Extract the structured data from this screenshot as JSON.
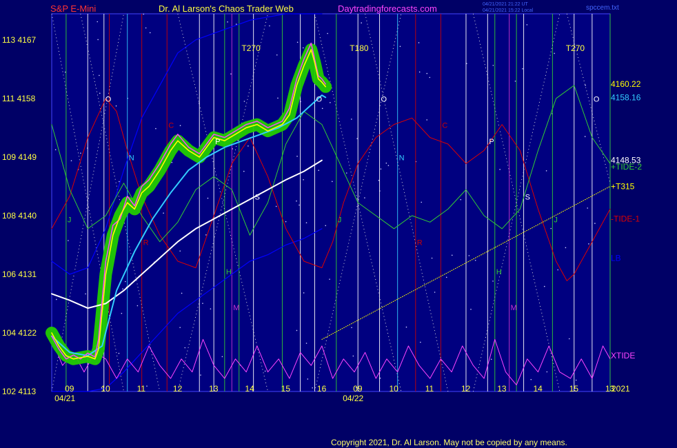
{
  "header": {
    "symbol": "S&P E-Mini",
    "title": "Dr. Al Larson's Chaos Trader Web",
    "site": "Daytradingforecasts.com",
    "stamp1": "04/21/2021 21:22 UT",
    "stamp2": "04/21/2021 15:22 Local",
    "file": "spccem.txt"
  },
  "footer": {
    "copyright": "Copyright 2021, Dr. Al Larson. May not be copied by any means."
  },
  "colors": {
    "background": "#000066",
    "plot_bg": "#000080",
    "axis": "#4444ff",
    "green_glow": "#22cc00",
    "yellow": "#ffff00",
    "magenta": "#ff44ff",
    "cyan": "#33ccff",
    "white": "#ffffff",
    "red": "#dd0000",
    "green": "#33cc33",
    "blue": "#0000ff",
    "pink": "#cc33cc"
  },
  "chart_data": {
    "type": "line",
    "y_left_ticks": [
      {
        "pair": "113  4167",
        "value": 4167
      },
      {
        "pair": "111  4158",
        "value": 4158
      },
      {
        "pair": "109  4149",
        "value": 4149
      },
      {
        "pair": "108  4140",
        "value": 4140
      },
      {
        "pair": "106  4131",
        "value": 4131
      },
      {
        "pair": "104  4122",
        "value": 4122
      },
      {
        "pair": "102  4113",
        "value": 4113
      }
    ],
    "ylim": [
      4113,
      4171
    ],
    "xlim": [
      8.5,
      24.0
    ],
    "x_ticks": [
      {
        "label": "09",
        "x": 9
      },
      {
        "label": "10",
        "x": 10
      },
      {
        "label": "11",
        "x": 11
      },
      {
        "label": "12",
        "x": 12
      },
      {
        "label": "13",
        "x": 13
      },
      {
        "label": "14",
        "x": 14
      },
      {
        "label": "15",
        "x": 15
      },
      {
        "label": "16",
        "x": 16
      },
      {
        "label": "09",
        "x": 17
      },
      {
        "label": "10",
        "x": 18
      },
      {
        "label": "11",
        "x": 19
      },
      {
        "label": "12",
        "x": 20
      },
      {
        "label": "13",
        "x": 21
      },
      {
        "label": "14",
        "x": 22
      },
      {
        "label": "15",
        "x": 23
      },
      {
        "label": "13",
        "x": 24
      }
    ],
    "dates": [
      {
        "label": "04/21",
        "x": 9
      },
      {
        "label": "04/22",
        "x": 17
      }
    ],
    "year": "2021",
    "top_markers": [
      {
        "label": "T270",
        "x": 14.0
      },
      {
        "label": "T180",
        "x": 17.0
      },
      {
        "label": "T270",
        "x": 23.0
      }
    ],
    "right_labels": [
      {
        "text": "4160.22",
        "value": 4160.2,
        "color": "#ffff00"
      },
      {
        "text": "4158.16",
        "value": 4158.16,
        "color": "#33ccff"
      },
      {
        "text": "4148.53",
        "value": 4148.53,
        "color": "#ffffff"
      },
      {
        "text": "+TIDE-2",
        "value": 4147.5,
        "color": "#33cc33"
      },
      {
        "text": "+T315",
        "value": 4144.5,
        "color": "#ffff00"
      },
      {
        "text": "-TIDE-1",
        "value": 4139.5,
        "color": "#dd0000"
      },
      {
        "text": "LB",
        "value": 4133.5,
        "color": "#0000ff"
      },
      {
        "text": "XTIDE",
        "value": 4118.5,
        "color": "#ff44ff"
      }
    ],
    "price": {
      "x": [
        8.5,
        8.7,
        8.9,
        9.1,
        9.3,
        9.5,
        9.7,
        9.8,
        10.0,
        10.2,
        10.4,
        10.6,
        10.8,
        11.0,
        11.2,
        11.5,
        11.8,
        12.0,
        12.3,
        12.6,
        12.8,
        13.0,
        13.3,
        13.6,
        13.9,
        14.2,
        14.5,
        14.7,
        14.9,
        15.1,
        15.3,
        15.5,
        15.7,
        15.8,
        15.9,
        16.0,
        16.1
      ],
      "y": [
        4122.0,
        4120.0,
        4118.5,
        4118.0,
        4118.2,
        4118.4,
        4118.0,
        4119.5,
        4131.0,
        4137.0,
        4140.0,
        4142.0,
        4141.0,
        4143.5,
        4144.5,
        4147.0,
        4150.0,
        4151.5,
        4150.0,
        4149.0,
        4150.5,
        4152.0,
        4151.5,
        4152.5,
        4153.5,
        4154.0,
        4153.0,
        4153.5,
        4154.0,
        4155.5,
        4160.0,
        4163.0,
        4165.5,
        4163.5,
        4161.0,
        4160.5,
        4159.8
      ]
    },
    "magenta_fast": {
      "x": [
        8.5,
        8.7,
        8.9,
        9.1,
        9.3,
        9.5,
        9.7,
        9.8,
        10.0,
        10.2,
        10.4,
        10.6,
        10.8,
        11.0,
        11.2,
        11.5,
        11.8,
        12.0,
        12.3,
        12.6,
        12.8,
        13.0,
        13.3,
        13.6,
        13.9,
        14.2,
        14.5,
        14.7,
        14.9,
        15.1,
        15.3,
        15.5,
        15.7,
        15.8,
        15.9,
        16.0,
        16.1
      ],
      "y": [
        4121.5,
        4119.5,
        4118.0,
        4118.6,
        4118.0,
        4118.9,
        4118.3,
        4121.0,
        4133.0,
        4138.5,
        4139.5,
        4143.0,
        4141.5,
        4144.5,
        4145.5,
        4148.0,
        4151.0,
        4152.5,
        4150.5,
        4149.5,
        4151.0,
        4152.5,
        4152.0,
        4153.0,
        4154.0,
        4154.5,
        4153.5,
        4154.0,
        4154.5,
        4156.5,
        4161.0,
        4164.0,
        4166.5,
        4164.0,
        4161.5,
        4161.0,
        4160.2
      ]
    },
    "cyan_avg": {
      "x": [
        8.5,
        9.0,
        9.5,
        9.9,
        10.3,
        10.8,
        11.3,
        11.8,
        12.3,
        12.8,
        13.3,
        13.8,
        14.3,
        14.8,
        15.3,
        15.7,
        16.0,
        16.1
      ],
      "y": [
        4121.5,
        4119.0,
        4118.5,
        4120.0,
        4128.5,
        4134.5,
        4139.5,
        4143.5,
        4147.0,
        4149.0,
        4150.5,
        4151.5,
        4152.5,
        4153.5,
        4155.0,
        4157.0,
        4158.5,
        4158.16
      ]
    },
    "white_avg": {
      "x": [
        8.5,
        9.0,
        9.5,
        10.0,
        10.5,
        11.0,
        11.5,
        12.0,
        12.5,
        13.0,
        13.5,
        14.0,
        14.5,
        15.0,
        15.5,
        16.0
      ],
      "y": [
        4128.0,
        4127.0,
        4125.8,
        4126.5,
        4128.5,
        4131.0,
        4133.5,
        4136.0,
        4138.0,
        4139.5,
        4141.0,
        4142.5,
        4144.0,
        4145.5,
        4146.8,
        4148.5
      ]
    },
    "tide1_red": {
      "x": [
        8.5,
        9.0,
        9.5,
        10.0,
        10.3,
        10.6,
        11.0,
        11.5,
        12.0,
        12.5,
        13.0,
        13.5,
        14.0,
        14.5,
        15.0,
        15.5,
        16.0,
        16.3,
        16.6,
        17.0,
        17.5,
        18.0,
        18.5,
        19.0,
        19.5,
        20.0,
        20.5,
        21.0,
        21.5,
        22.0,
        22.5,
        22.8,
        23.0,
        23.5,
        24.0
      ],
      "y": [
        4138,
        4143,
        4152,
        4158,
        4156,
        4150,
        4143,
        4137,
        4133,
        4132,
        4140,
        4148,
        4152,
        4146,
        4138,
        4133,
        4132,
        4136,
        4142,
        4148,
        4152,
        4154,
        4155,
        4152,
        4151,
        4148,
        4150,
        4154,
        4150,
        4141,
        4133,
        4130,
        4131,
        4136,
        4141
      ]
    },
    "tide2_green": {
      "x": [
        8.5,
        9.0,
        9.5,
        10.0,
        10.5,
        11.0,
        11.5,
        12.0,
        12.5,
        13.0,
        13.5,
        14.0,
        14.5,
        15.0,
        15.5,
        16.0,
        16.5,
        17.0,
        17.5,
        18.0,
        18.5,
        19.0,
        19.5,
        20.0,
        20.5,
        21.0,
        21.5,
        22.0,
        22.5,
        23.0,
        23.5,
        24.0
      ],
      "y": [
        4154,
        4144,
        4138,
        4140,
        4145,
        4140,
        4136,
        4139,
        4144,
        4146,
        4144,
        4137,
        4142,
        4151,
        4156,
        4154,
        4148,
        4142,
        4140,
        4138,
        4140,
        4139,
        4141,
        4144,
        4140,
        4138,
        4141,
        4150,
        4158,
        4160,
        4152,
        4148
      ]
    },
    "xtide": {
      "x": [
        8.5,
        8.8,
        9.1,
        9.4,
        9.7,
        10.0,
        10.3,
        10.6,
        10.9,
        11.2,
        11.5,
        11.8,
        12.1,
        12.4,
        12.7,
        13.0,
        13.3,
        13.6,
        13.9,
        14.2,
        14.5,
        14.8,
        15.1,
        15.4,
        15.7,
        16.0,
        16.3,
        16.6,
        16.9,
        17.2,
        17.5,
        17.8,
        18.1,
        18.4,
        18.7,
        19.0,
        19.3,
        19.6,
        19.9,
        20.2,
        20.5,
        20.8,
        21.1,
        21.4,
        21.7,
        22.0,
        22.3,
        22.6,
        22.9,
        23.2,
        23.5,
        23.8,
        24.0
      ],
      "y": [
        4121,
        4117,
        4119,
        4116,
        4119,
        4118,
        4115,
        4118,
        4116,
        4120,
        4117,
        4115,
        4118,
        4116,
        4121,
        4117,
        4115,
        4118,
        4116,
        4120,
        4116,
        4118,
        4115,
        4119,
        4117,
        4120,
        4115,
        4118,
        4116,
        4119,
        4115,
        4118,
        4116,
        4120,
        4117,
        4115,
        4118,
        4116,
        4120,
        4117,
        4115,
        4121,
        4116,
        4114,
        4118,
        4116,
        4120,
        4116,
        4115,
        4118,
        4115,
        4120,
        4118
      ]
    },
    "band_upper": {
      "x": [
        8.5,
        9.0,
        9.5,
        10.0,
        10.5,
        11.0,
        11.5,
        12.0,
        12.5,
        13.0,
        13.5,
        14.0,
        14.5,
        15.0,
        15.5,
        16.0
      ],
      "y": [
        4133,
        4131,
        4132,
        4138,
        4147,
        4155,
        4160,
        4165,
        4167,
        4168,
        4169,
        4170,
        4170.5,
        4171,
        4171,
        4171
      ]
    },
    "band_lower": {
      "x": [
        8.5,
        9.0,
        9.5,
        10.0,
        10.5,
        11.0,
        11.5,
        12.0,
        12.5,
        13.0,
        13.5,
        14.0,
        14.5,
        15.0,
        15.5,
        16.0
      ],
      "y": [
        4113,
        4113,
        4113,
        4113.5,
        4116,
        4119,
        4122,
        4125,
        4127,
        4129,
        4131,
        4133,
        4134,
        4135.5,
        4136.5,
        4138
      ]
    },
    "t315_line": {
      "x": [
        16.0,
        24.0
      ],
      "y": [
        4121.0,
        4144.5
      ]
    },
    "vertical_lines": [
      {
        "x": 8.9,
        "label": "J",
        "label_value": 4139.0,
        "color": "#33cc33",
        "label_color": "#33cc33",
        "style": "solid"
      },
      {
        "x": 9.5,
        "label": "",
        "color": "#ffffff",
        "style": "solid"
      },
      {
        "x": 9.95,
        "label": "O",
        "label_value": 4157.5,
        "color": "#ffffff",
        "label_color": "#ffffff",
        "style": "solid"
      },
      {
        "x": 10.1,
        "label": "",
        "color": "#cc0000",
        "style": "solid"
      },
      {
        "x": 10.6,
        "label": "N",
        "label_value": 4148.5,
        "color": "#33ccff",
        "label_color": "#33ccff",
        "style": "solid"
      },
      {
        "x": 11.0,
        "label": "R",
        "label_value": 4135.5,
        "color": "#cc0000",
        "label_color": "#cc0000",
        "style": "solid"
      },
      {
        "x": 11.7,
        "label": "C",
        "label_value": 4153.5,
        "color": "#cc0000",
        "label_color": "#cc0000",
        "style": "solid"
      },
      {
        "x": 12.6,
        "label": "",
        "color": "#ffffff",
        "style": "solid"
      },
      {
        "x": 13.0,
        "label": "P",
        "label_value": 4151.0,
        "color": "#ffffff",
        "label_color": "#ffffff",
        "style": "solid"
      },
      {
        "x": 13.3,
        "label": "H",
        "label_value": 4131.0,
        "color": "#33cc33",
        "label_color": "#33cc33",
        "style": "solid"
      },
      {
        "x": 13.5,
        "label": "M",
        "label_value": 4125.5,
        "color": "#cc33cc",
        "label_color": "#cc33cc",
        "style": "solid"
      },
      {
        "x": 13.7,
        "label": "",
        "color": "#33cc33",
        "style": "solid"
      },
      {
        "x": 14.1,
        "label": "S",
        "label_value": 4142.5,
        "color": "#ffffff",
        "label_color": "#ffffff",
        "style": "solid"
      },
      {
        "x": 14.9,
        "label": "",
        "color": "#33cc33",
        "style": "solid"
      },
      {
        "x": 15.4,
        "label": "",
        "color": "#ffffff",
        "style": "solid"
      },
      {
        "x": 15.8,
        "label": "O",
        "label_value": 4157.5,
        "color": "#ffffff",
        "label_color": "#ffffff",
        "style": "solid"
      },
      {
        "x": 16.4,
        "label": "J",
        "label_value": 4139.0,
        "color": "#33cc33",
        "label_color": "#33cc33",
        "style": "solid"
      },
      {
        "x": 17.0,
        "label": "",
        "color": "#ffffff",
        "style": "solid"
      },
      {
        "x": 17.6,
        "label": "O",
        "label_value": 4157.5,
        "color": "#ffffff",
        "label_color": "#ffffff",
        "style": "solid"
      },
      {
        "x": 18.1,
        "label": "N",
        "label_value": 4148.5,
        "color": "#33ccff",
        "label_color": "#33ccff",
        "style": "solid"
      },
      {
        "x": 18.6,
        "label": "R",
        "label_value": 4135.5,
        "color": "#cc0000",
        "label_color": "#cc0000",
        "style": "solid"
      },
      {
        "x": 19.3,
        "label": "C",
        "label_value": 4153.5,
        "color": "#cc0000",
        "label_color": "#cc0000",
        "style": "solid"
      },
      {
        "x": 20.0,
        "label": "",
        "color": "#ffffff",
        "style": "solid"
      },
      {
        "x": 20.6,
        "label": "P",
        "label_value": 4151.0,
        "color": "#ffffff",
        "label_color": "#ffffff",
        "style": "solid"
      },
      {
        "x": 20.8,
        "label": "H",
        "label_value": 4131.0,
        "color": "#33cc33",
        "label_color": "#33cc33",
        "style": "solid"
      },
      {
        "x": 21.2,
        "label": "M",
        "label_value": 4125.5,
        "color": "#cc33cc",
        "label_color": "#cc33cc",
        "style": "solid"
      },
      {
        "x": 21.4,
        "label": "",
        "color": "#33cc33",
        "style": "solid"
      },
      {
        "x": 21.6,
        "label": "S",
        "label_value": 4142.5,
        "color": "#ffffff",
        "label_color": "#ffffff",
        "style": "solid"
      },
      {
        "x": 22.4,
        "label": "J",
        "label_value": 4139.0,
        "color": "#33cc33",
        "label_color": "#33cc33",
        "style": "solid"
      },
      {
        "x": 23.0,
        "label": "",
        "color": "#ffffff",
        "style": "solid"
      },
      {
        "x": 23.5,
        "label": "O",
        "label_value": 4157.5,
        "color": "#ffffff",
        "label_color": "#ffffff",
        "style": "solid"
      },
      {
        "x": 24.0,
        "label": "",
        "color": "#33cc33",
        "style": "solid"
      }
    ],
    "grid": false,
    "legend": "right"
  }
}
